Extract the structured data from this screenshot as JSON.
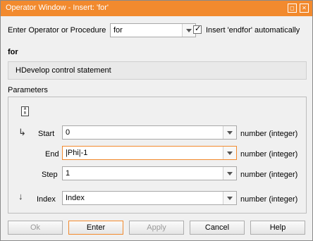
{
  "window": {
    "title": "Operator Window - Insert: 'for'",
    "buttons": [
      "pin-icon",
      "close-icon"
    ]
  },
  "top": {
    "operator_label": "Enter Operator or Procedure",
    "operator_value": "for",
    "insert_checkbox_label": "Insert 'endfor'  automatically",
    "insert_checked": true
  },
  "operator": {
    "name": "for",
    "description": "HDevelop control statement"
  },
  "parameters": {
    "title": "Parameters",
    "rows": [
      {
        "label": "Start",
        "value": "0",
        "type": "number (integer)"
      },
      {
        "label": "End",
        "value": "|Phi|-1",
        "type": "number (integer)"
      },
      {
        "label": "Step",
        "value": "1",
        "type": "number (integer)"
      },
      {
        "label": "Index",
        "value": "Index",
        "type": "number (integer)"
      }
    ]
  },
  "buttons": {
    "ok": "Ok",
    "enter": "Enter",
    "apply": "Apply",
    "cancel": "Cancel",
    "help": "Help"
  },
  "colors": {
    "accent": "#f28a2e"
  }
}
